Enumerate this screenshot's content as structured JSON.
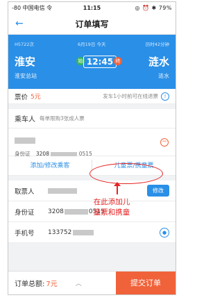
{
  "status_bar": {
    "carrier": "-80 中国电信 令",
    "time": "11:15",
    "indicators": "◎ ⏰ ✱ 79%"
  },
  "header": {
    "title": "订单填写",
    "back_icon": "arrow-left-icon"
  },
  "train": {
    "number": "H5722次",
    "date": "6月19日 今天",
    "duration": "历时42分钟",
    "from_city": "淮安",
    "to_city": "涟水",
    "from_station": "淮安总站",
    "to_station": "涟水",
    "depart_time": "12:45",
    "start_mark": "始",
    "end_mark": "终"
  },
  "price": {
    "label": "票价",
    "value": "5元",
    "refund_hint": "发车1小时前可在线退票",
    "info_icon": "info-icon"
  },
  "passenger": {
    "title": "乘车人",
    "tip": "每单限购3张成人票",
    "id_label": "身份证",
    "id_prefix": "3208",
    "id_suffix": "0515",
    "remove_icon": "minus-circle-icon",
    "add_edit_label": "添加/修改乘客",
    "child_ticket_label": "儿童票/携童票"
  },
  "annotation": {
    "line1": "在此添加儿",
    "line2": "童票和携童"
  },
  "ticket_holder": {
    "label": "取票人",
    "edit_label": "修改",
    "id_label": "身份证",
    "id_prefix": "3208",
    "id_suffix": "0515",
    "phone_label": "手机号",
    "phone_prefix": "133752",
    "contact_icon": "contact-icon"
  },
  "footer": {
    "total_label": "订单总额:",
    "total_value": "7元",
    "caret": "︿",
    "submit_label": "提交订单"
  },
  "colors": {
    "accent": "#2a8fe6",
    "orange": "#f0623a",
    "annotation": "#e52323"
  }
}
